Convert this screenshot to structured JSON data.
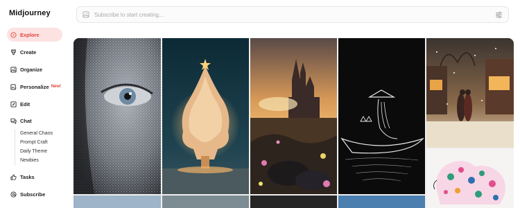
{
  "app": {
    "title": "Midjourney"
  },
  "sidebar": {
    "items": [
      {
        "label": "Explore",
        "icon": "compass-icon",
        "active": true
      },
      {
        "label": "Create",
        "icon": "brush-icon"
      },
      {
        "label": "Organize",
        "icon": "image-icon"
      },
      {
        "label": "Personalize",
        "icon": "image-edit-icon",
        "badge": "New!"
      },
      {
        "label": "Edit",
        "icon": "pencil-icon"
      },
      {
        "label": "Chat",
        "icon": "chat-icon"
      },
      {
        "label": "Tasks",
        "icon": "thumbs-up-icon"
      },
      {
        "label": "Subscribe",
        "icon": "at-sign-icon"
      }
    ],
    "chat_rooms": [
      "General Chaos",
      "Prompt Craft",
      "Daily Theme",
      "Newbies"
    ]
  },
  "search": {
    "placeholder": "Subscribe to start creating...",
    "icon": "image-icon",
    "filter_icon": "sliders-icon"
  },
  "gallery": {
    "images": [
      {
        "name": "glitter-face-eye-image"
      },
      {
        "name": "cloud-christmas-tree-image"
      },
      {
        "name": "castle-sunset-flowers-image"
      },
      {
        "name": "line-art-rower-boat-image"
      },
      {
        "name": "snowy-street-couple-image"
      },
      {
        "name": "colorful-leopard-image"
      }
    ]
  },
  "colors": {
    "accent": "#e0453a",
    "active_bg": "#fde2e2"
  }
}
